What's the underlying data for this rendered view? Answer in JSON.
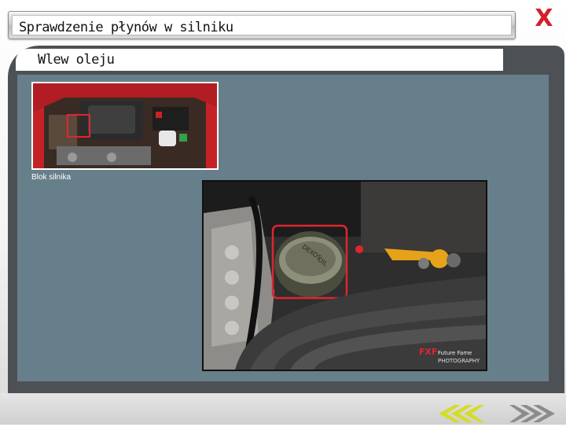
{
  "header": {
    "title": "Sprawdzenie płynów w silniku"
  },
  "close": {
    "label": "X",
    "color": "#d2222a"
  },
  "section": {
    "subtitle": "Wlew oleju"
  },
  "thumbnail": {
    "caption": "Blok silnika"
  },
  "photo": {
    "watermark_brand": "Future Fame",
    "watermark_sub": "PHOTOGRAPHY",
    "cap_text_1": "DEXOS",
    "cap_text_2": "OIL"
  },
  "navigation": {
    "prev_icon": "double-chevron-left-icon",
    "next_icon": "double-chevron-right-icon",
    "prev_color": "#d4dc28",
    "next_color": "#8c8c8c"
  },
  "colors": {
    "panel": "#677f8a",
    "dark_frame": "#4d5155",
    "highlight": "#e0252e"
  }
}
